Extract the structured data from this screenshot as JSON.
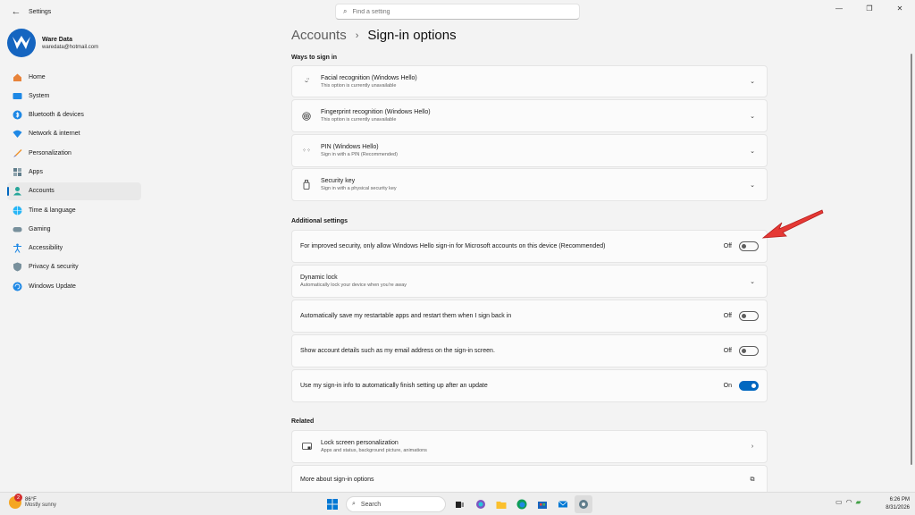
{
  "app": {
    "title": "Settings"
  },
  "search": {
    "placeholder": "Find a setting"
  },
  "profile": {
    "name": "Ware Data",
    "email": "waredata@hotmail.com"
  },
  "nav": [
    {
      "label": "Home",
      "icon": "home-icon"
    },
    {
      "label": "System",
      "icon": "system-icon"
    },
    {
      "label": "Bluetooth & devices",
      "icon": "bluetooth-icon"
    },
    {
      "label": "Network & internet",
      "icon": "network-icon"
    },
    {
      "label": "Personalization",
      "icon": "brush-icon"
    },
    {
      "label": "Apps",
      "icon": "apps-icon"
    },
    {
      "label": "Accounts",
      "icon": "accounts-icon",
      "active": true
    },
    {
      "label": "Time & language",
      "icon": "globe-icon"
    },
    {
      "label": "Gaming",
      "icon": "gamepad-icon"
    },
    {
      "label": "Accessibility",
      "icon": "accessibility-icon"
    },
    {
      "label": "Privacy & security",
      "icon": "shield-icon"
    },
    {
      "label": "Windows Update",
      "icon": "update-icon"
    }
  ],
  "breadcrumb": {
    "parent": "Accounts",
    "separator": "›",
    "current": "Sign-in options"
  },
  "ways": {
    "heading": "Ways to sign in",
    "items": [
      {
        "title": "Facial recognition (Windows Hello)",
        "subtitle": "This option is currently unavailable",
        "icon": "face-icon"
      },
      {
        "title": "Fingerprint recognition (Windows Hello)",
        "subtitle": "This option is currently unavailable",
        "icon": "fingerprint-icon"
      },
      {
        "title": "PIN (Windows Hello)",
        "subtitle": "Sign in with a PIN (Recommended)",
        "icon": "pin-icon"
      },
      {
        "title": "Security key",
        "subtitle": "Sign in with a physical security key",
        "icon": "security-key-icon"
      }
    ]
  },
  "additional": {
    "heading": "Additional settings",
    "hello_only": {
      "label": "For improved security, only allow Windows Hello sign-in for Microsoft accounts on this device (Recommended)",
      "state": "Off"
    },
    "dynamic_lock": {
      "title": "Dynamic lock",
      "subtitle": "Automatically lock your device when you're away"
    },
    "restart_apps": {
      "label": "Automatically save my restartable apps and restart them when I sign back in",
      "state": "Off"
    },
    "account_details": {
      "label": "Show account details such as my email address on the sign-in screen.",
      "state": "Off"
    },
    "signin_info": {
      "label": "Use my sign-in info to automatically finish setting up after an update",
      "state": "On"
    }
  },
  "related": {
    "heading": "Related",
    "lock_screen": {
      "title": "Lock screen personalization",
      "subtitle": "Apps and status, background picture, animations"
    },
    "more_about": {
      "title": "More about sign-in options"
    }
  },
  "colors": {
    "accent": "#0067c0",
    "arrow": "#e53935"
  },
  "taskbar": {
    "weather_badge": "2",
    "weather_temp": "86°F",
    "weather_desc": "Mostly sunny",
    "search_label": "Search",
    "time": "6:26 PM",
    "date": "8/31/2026"
  }
}
